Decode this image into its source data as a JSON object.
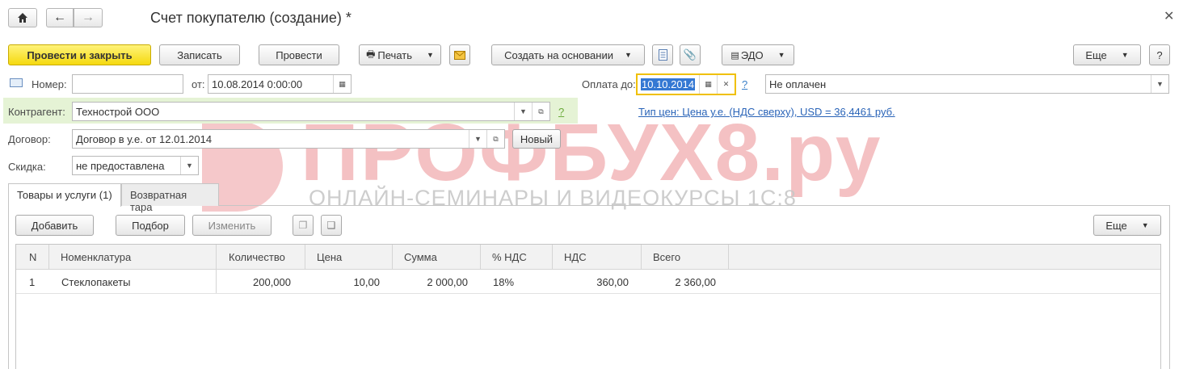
{
  "window": {
    "title": "Счет покупателю (создание) *"
  },
  "toolbar": {
    "post_close": "Провести и закрыть",
    "save": "Записать",
    "post": "Провести",
    "print": "Печать",
    "create_based": "Создать на основании",
    "edo": "ЭДО",
    "more": "Еще",
    "help": "?"
  },
  "form": {
    "number_label": "Номер:",
    "number_value": "",
    "from_label": "от:",
    "date_value": "10.08.2014  0:00:00",
    "pay_until_label": "Оплата до:",
    "pay_until_value": "10.10.2014",
    "payment_status": "Не оплачен",
    "question": "?",
    "counterparty_label": "Контрагент:",
    "counterparty_value": "Технострой ООО",
    "price_type_link": "Тип цен: Цена у.е. (НДС сверху), USD = 36,4461 руб.",
    "contract_label": "Договор:",
    "contract_value": "Договор в у.е. от 12.01.2014",
    "new_button": "Новый",
    "discount_label": "Скидка:",
    "discount_value": "не предоставлена"
  },
  "tabs": [
    {
      "label": "Товары и услуги (1)"
    },
    {
      "label": "Возвратная тара"
    }
  ],
  "table_toolbar": {
    "add": "Добавить",
    "pick": "Подбор",
    "edit": "Изменить",
    "more": "Еще"
  },
  "table": {
    "headers": [
      "N",
      "Номенклатура",
      "Количество",
      "Цена",
      "Сумма",
      "% НДС",
      "НДС",
      "Всего"
    ],
    "rows": [
      [
        "1",
        "Стеклопакеты",
        "200,000",
        "10,00",
        "2 000,00",
        "18%",
        "360,00",
        "2 360,00"
      ]
    ]
  },
  "watermark": {
    "brand": "ПРОФБУХ8.ру",
    "tagline": "ОНЛАЙН-СЕМИНАРЫ И ВИДЕОКУРСЫ 1С:8"
  },
  "colors": {
    "primary_button": "#f5d90f",
    "counterparty_highlight": "#e5f3d5",
    "link": "#2a64b8",
    "focus_border": "#f0c000"
  }
}
